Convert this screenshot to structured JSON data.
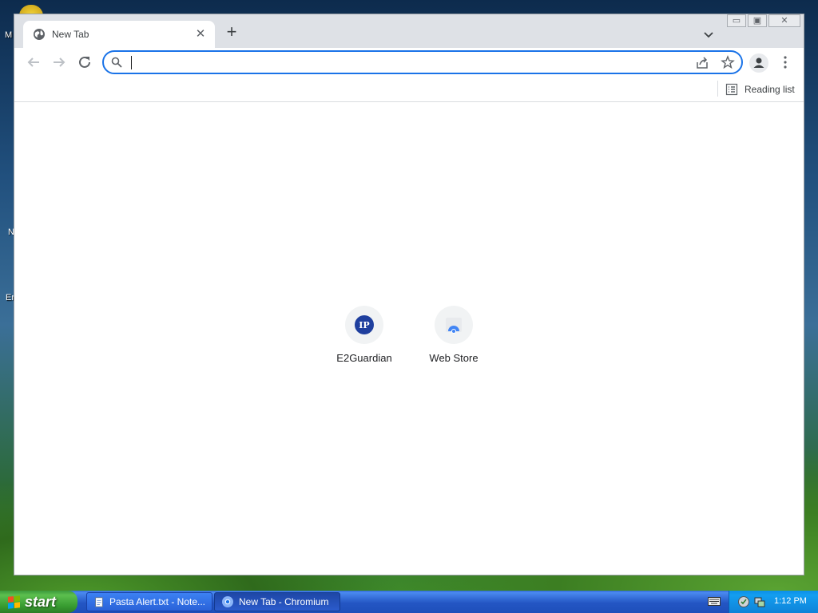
{
  "desktop": {
    "labels": [
      "M",
      "N",
      "Er"
    ]
  },
  "browser": {
    "tab": {
      "title": "New Tab",
      "close_glyph": "✕"
    },
    "new_tab_glyph": "+",
    "caption": {
      "minimize": "▭",
      "restore": "▣",
      "close": "✕"
    },
    "omnibox": {
      "value": "",
      "placeholder": ""
    },
    "bookmark_bar": {
      "reading_list_label": "Reading list"
    },
    "shortcuts": [
      {
        "label": "E2Guardian",
        "icon_text": "IP"
      },
      {
        "label": "Web Store"
      }
    ],
    "colors": {
      "accent": "#1a73e8",
      "tabstrip": "#dee1e6"
    }
  },
  "taskbar": {
    "start_label": "start",
    "tasks": [
      {
        "label": "Pasta Alert.txt - Note..."
      },
      {
        "label": "New Tab - Chromium"
      }
    ],
    "clock": "1:12 PM"
  }
}
